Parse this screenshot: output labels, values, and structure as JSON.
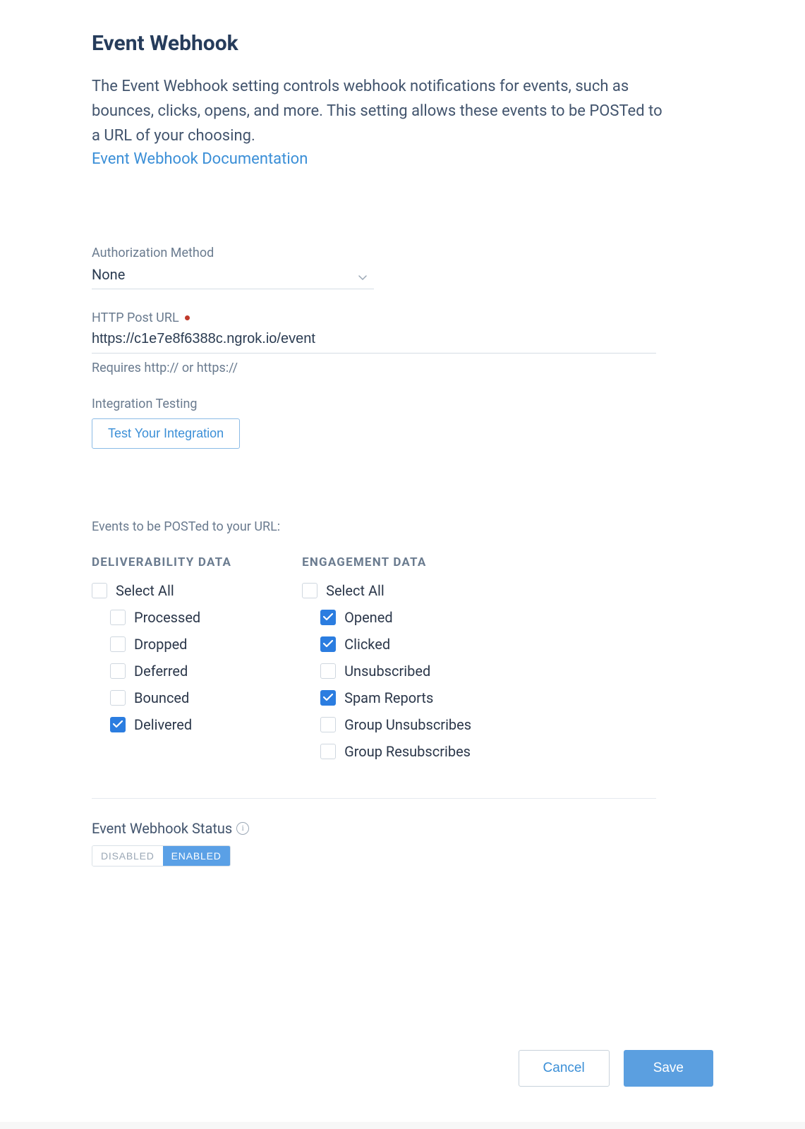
{
  "title": "Event Webhook",
  "description": "The Event Webhook setting controls webhook notifications for events, such as bounces, clicks, opens, and more. This setting allows these events to be POSTed to a URL of your choosing.",
  "doc_link_label": "Event Webhook Documentation",
  "auth": {
    "label": "Authorization Method",
    "value": "None"
  },
  "post_url": {
    "label": "HTTP Post URL",
    "value": "https://c1e7e8f6388c.ngrok.io/event",
    "helper": "Requires http:// or https://"
  },
  "integration_testing": {
    "label": "Integration Testing",
    "button": "Test Your Integration"
  },
  "events": {
    "heading": "Events to be POSTed to your URL:",
    "deliverability": {
      "title": "DELIVERABILITY DATA",
      "select_all": {
        "label": "Select All",
        "checked": false
      },
      "items": [
        {
          "label": "Processed",
          "checked": false
        },
        {
          "label": "Dropped",
          "checked": false
        },
        {
          "label": "Deferred",
          "checked": false
        },
        {
          "label": "Bounced",
          "checked": false
        },
        {
          "label": "Delivered",
          "checked": true
        }
      ]
    },
    "engagement": {
      "title": "ENGAGEMENT DATA",
      "select_all": {
        "label": "Select All",
        "checked": false
      },
      "items": [
        {
          "label": "Opened",
          "checked": true
        },
        {
          "label": "Clicked",
          "checked": true
        },
        {
          "label": "Unsubscribed",
          "checked": false
        },
        {
          "label": "Spam Reports",
          "checked": true
        },
        {
          "label": "Group Unsubscribes",
          "checked": false
        },
        {
          "label": "Group Resubscribes",
          "checked": false
        }
      ]
    }
  },
  "status": {
    "label": "Event Webhook Status",
    "disabled_label": "DISABLED",
    "enabled_label": "ENABLED",
    "active": "enabled"
  },
  "actions": {
    "cancel": "Cancel",
    "save": "Save"
  }
}
